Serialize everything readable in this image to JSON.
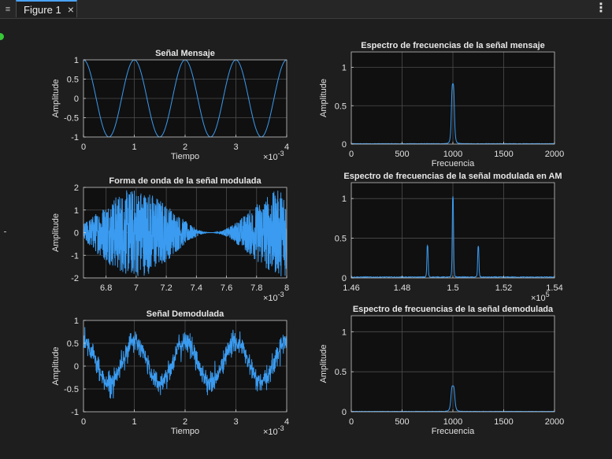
{
  "window": {
    "tab_label": "Figure 1",
    "close_glyph": "×",
    "menu_glyph": "⋮",
    "grip_glyph": "≡"
  },
  "colors": {
    "figure_bg": "#1e1e1e",
    "axes_bg": "#101010",
    "grid": "#4d4d4d",
    "line": "#3a9bf0",
    "tab_accent": "#4aa3ff",
    "status_dot": "#37c837"
  },
  "chart_data": [
    {
      "id": "mensaje",
      "type": "line",
      "title": "Señal Mensaje",
      "xlabel": "Tiempo",
      "ylabel": "Amplitude",
      "xlim": [
        0,
        0.004
      ],
      "ylim": [
        -1,
        1
      ],
      "xticks": [
        0,
        0.001,
        0.002,
        0.003,
        0.004
      ],
      "xtick_labels": [
        "0",
        "1",
        "2",
        "3",
        "4"
      ],
      "x_exponent": "×10",
      "x_exponent_power": "-3",
      "yticks": [
        -1,
        -0.5,
        0,
        0.5,
        1
      ],
      "ytick_labels": [
        "-1",
        "-0.5",
        "0",
        "0.5",
        "1"
      ],
      "grid": true,
      "series": [
        {
          "signal": "cos",
          "frequency": 1000,
          "amplitude": 1
        }
      ]
    },
    {
      "id": "espectro_mensaje",
      "type": "line",
      "title": "Espectro de frecuencias de la señal mensaje",
      "xlabel": "Frecuencia",
      "ylabel": "Amplitude",
      "xlim": [
        0,
        2000
      ],
      "ylim": [
        0,
        1.2
      ],
      "xticks": [
        0,
        500,
        1000,
        1500,
        2000
      ],
      "xtick_labels": [
        "0",
        "500",
        "1000",
        "1500",
        "2000"
      ],
      "yticks": [
        0,
        0.5,
        1
      ],
      "ytick_labels": [
        "0",
        "0.5",
        "1"
      ],
      "grid": true,
      "series": [
        {
          "signal": "spectrum",
          "peaks": [
            {
              "f": 1000,
              "a": 0.78
            }
          ],
          "width": 14,
          "floor": 0.005
        }
      ]
    },
    {
      "id": "modulada",
      "type": "line",
      "title": "Forma de onda de la señal modulada",
      "xlabel": "",
      "ylabel": "Amplitude",
      "xlim": [
        0.00665,
        0.008
      ],
      "ylim": [
        -2,
        2
      ],
      "xticks": [
        0.0068,
        0.007,
        0.0072,
        0.0074,
        0.0076,
        0.0078,
        0.008
      ],
      "xtick_labels": [
        "6.8",
        "7",
        "7.2",
        "7.4",
        "7.6",
        "7.8",
        "8"
      ],
      "x_exponent": "×10",
      "x_exponent_power": "-3",
      "yticks": [
        -2,
        -1,
        0,
        1,
        2
      ],
      "ytick_labels": [
        "-2",
        "-1",
        "0",
        "1",
        "2"
      ],
      "grid": true,
      "series": [
        {
          "signal": "am",
          "carrier": 150000,
          "message": 1000,
          "modulation_index": 1
        }
      ]
    },
    {
      "id": "espectro_modulada",
      "type": "line",
      "title": "Espectro de frecuencias de la señal modulada en AM",
      "xlabel": "",
      "ylabel": "",
      "xlim": [
        146000,
        154000
      ],
      "ylim": [
        0,
        1.2
      ],
      "xticks": [
        146000,
        148000,
        150000,
        152000,
        154000
      ],
      "xtick_labels": [
        "1.46",
        "1.48",
        "1.5",
        "1.52",
        "1.54"
      ],
      "x_exponent": "×10",
      "x_exponent_power": "5",
      "yticks": [
        0,
        0.5,
        1
      ],
      "ytick_labels": [
        "0",
        "0.5",
        "1"
      ],
      "grid": true,
      "series": [
        {
          "signal": "spectrum",
          "peaks": [
            {
              "f": 149000,
              "a": 0.4
            },
            {
              "f": 150000,
              "a": 1.02
            },
            {
              "f": 151000,
              "a": 0.39
            }
          ],
          "width": 25,
          "floor": 0.01
        }
      ]
    },
    {
      "id": "demodulada",
      "type": "line",
      "title": "Señal Demodulada",
      "xlabel": "Tiempo",
      "ylabel": "Amplitude",
      "xlim": [
        0,
        0.004
      ],
      "ylim": [
        -1,
        1
      ],
      "xticks": [
        0,
        0.001,
        0.002,
        0.003,
        0.004
      ],
      "xtick_labels": [
        "0",
        "1",
        "2",
        "3",
        "4"
      ],
      "x_exponent": "×10",
      "x_exponent_power": "-3",
      "yticks": [
        -1,
        -0.5,
        0,
        0.5,
        1
      ],
      "ytick_labels": [
        "-1",
        "-0.5",
        "0",
        "0.5",
        "1"
      ],
      "grid": true,
      "series": [
        {
          "signal": "noisy_cos",
          "frequency": 1000,
          "amplitude": 0.45,
          "offset": 0.08,
          "noise": 0.17
        }
      ]
    },
    {
      "id": "espectro_demodulada",
      "type": "line",
      "title": "Espectro de frecuencias de la señal demodulada",
      "xlabel": "Frecuencia",
      "ylabel": "Amplitude",
      "xlim": [
        0,
        2000
      ],
      "ylim": [
        0,
        1.2
      ],
      "xticks": [
        0,
        500,
        1000,
        1500,
        2000
      ],
      "xtick_labels": [
        "0",
        "500",
        "1000",
        "1500",
        "2000"
      ],
      "yticks": [
        0,
        0.5,
        1
      ],
      "ytick_labels": [
        "0",
        "0.5",
        "1"
      ],
      "grid": true,
      "series": [
        {
          "signal": "spectrum",
          "peaks": [
            {
              "f": 1000,
              "a": 0.32
            }
          ],
          "width": 18,
          "floor": 0.004
        }
      ]
    }
  ]
}
